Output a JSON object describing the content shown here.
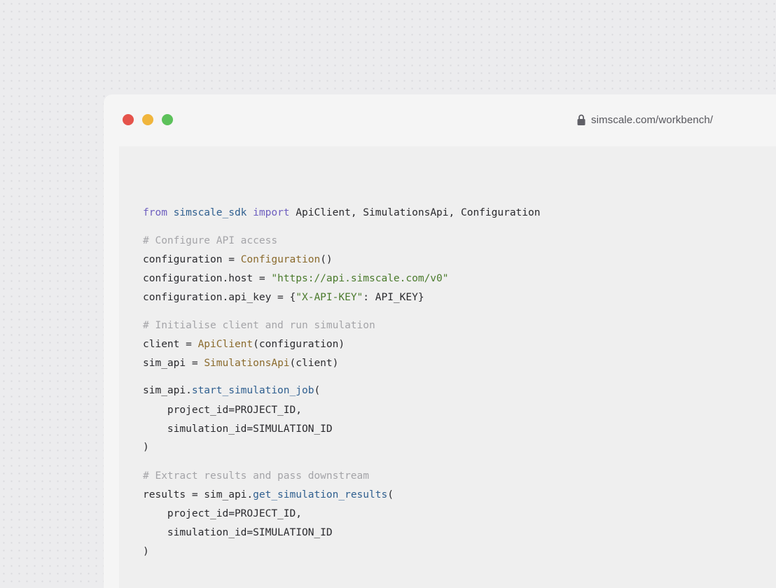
{
  "window": {
    "url": "simscale.com/workbench/",
    "traffic_lights": {
      "close_color": "#e5534b",
      "minimize_color": "#f0b53c",
      "maximize_color": "#5cc15a"
    }
  },
  "code": {
    "language": "python",
    "lines": {
      "l01": {
        "kw1": "from",
        "mod": "simscale_sdk",
        "kw2": "import",
        "rest": " ApiClient, SimulationsApi, Configuration"
      },
      "l02": {
        "comment": "# Configure API access"
      },
      "l03": {
        "lhs": "configuration = ",
        "cls": "Configuration",
        "rest": "()"
      },
      "l04": {
        "lhs": "configuration.host = ",
        "str": "\"https://api.simscale.com/v0\""
      },
      "l05": {
        "lhs": "configuration.api_key = {",
        "str": "\"X-API-KEY\"",
        "rest": ": API_KEY}"
      },
      "l06": {
        "comment": "# Initialise client and run simulation"
      },
      "l07": {
        "lhs": "client = ",
        "cls": "ApiClient",
        "rest": "(configuration)"
      },
      "l08": {
        "lhs": "sim_api = ",
        "cls": "SimulationsApi",
        "rest": "(client)"
      },
      "l09": {
        "lhs": "sim_api.",
        "fn": "start_simulation_job",
        "rest": "("
      },
      "l10": {
        "text": "    project_id=PROJECT_ID,"
      },
      "l11": {
        "text": "    simulation_id=SIMULATION_ID"
      },
      "l12": {
        "text": ")"
      },
      "l13": {
        "comment": "# Extract results and pass downstream"
      },
      "l14": {
        "lhs": "results = sim_api.",
        "fn": "get_simulation_results",
        "rest": "("
      },
      "l15": {
        "text": "    project_id=PROJECT_ID,"
      },
      "l16": {
        "text": "    simulation_id=SIMULATION_ID"
      },
      "l17": {
        "text": ")"
      }
    }
  },
  "icons": {
    "url_bar": "lock-icon"
  },
  "colors": {
    "keyword": "#6e5fbf",
    "module": "#2f5f8f",
    "class": "#8a6a2c",
    "function": "#2f5f8f",
    "string": "#4a7a2c",
    "comment": "#a4a4a8"
  }
}
